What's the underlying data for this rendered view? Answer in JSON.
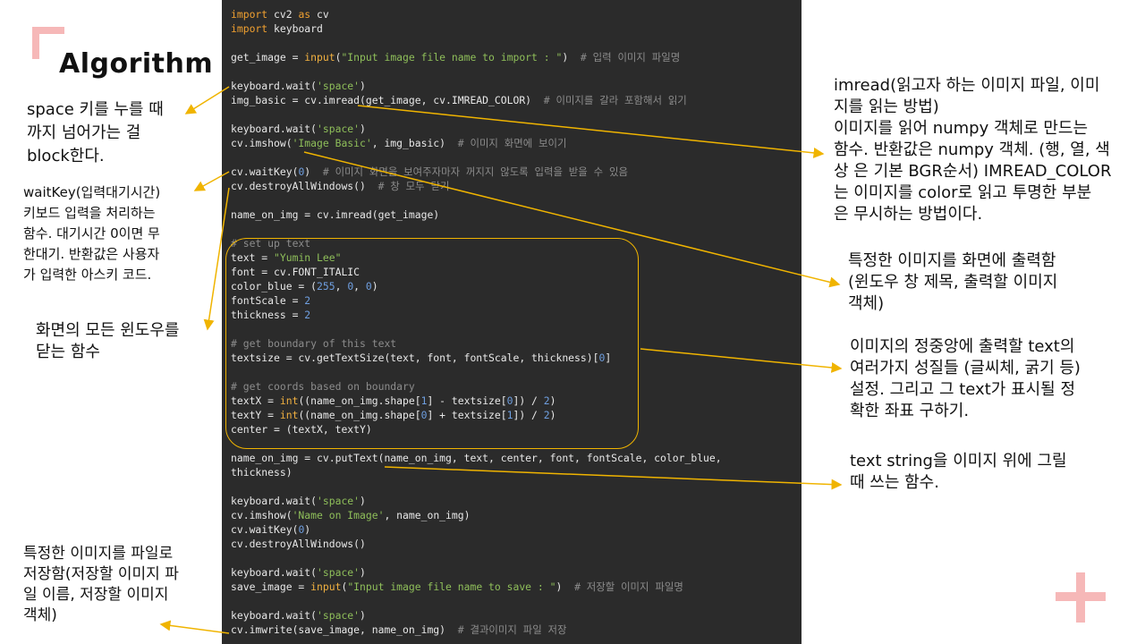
{
  "title": "Algorithm",
  "code_lines": [
    [
      [
        "kw",
        "import"
      ],
      [
        "t",
        " cv2 "
      ],
      [
        "kw",
        "as"
      ],
      [
        "t",
        " cv"
      ]
    ],
    [
      [
        "kw",
        "import"
      ],
      [
        "t",
        " keyboard"
      ]
    ],
    [],
    [
      [
        "t",
        "get_image = "
      ],
      [
        "fn",
        "input"
      ],
      [
        "t",
        "("
      ],
      [
        "str",
        "\"Input image file name to import : \""
      ],
      [
        "t",
        ")  "
      ],
      [
        "cmt",
        "# 입력 이미지 파일명"
      ]
    ],
    [],
    [
      [
        "t",
        "keyboard.wait("
      ],
      [
        "str",
        "'space'"
      ],
      [
        "t",
        ")"
      ]
    ],
    [
      [
        "t",
        "img_basic = cv.imread(get_image, cv.IMREAD_COLOR)  "
      ],
      [
        "cmt",
        "# 이미지를 갈라 포함해서 읽기"
      ]
    ],
    [],
    [
      [
        "t",
        "keyboard.wait("
      ],
      [
        "str",
        "'space'"
      ],
      [
        "t",
        ")"
      ]
    ],
    [
      [
        "t",
        "cv.imshow("
      ],
      [
        "str",
        "'Image Basic'"
      ],
      [
        "t",
        ", img_basic)  "
      ],
      [
        "cmt",
        "# 이미지 화면에 보이기"
      ]
    ],
    [],
    [
      [
        "t",
        "cv.waitKey("
      ],
      [
        "num",
        "0"
      ],
      [
        "t",
        ")  "
      ],
      [
        "cmt",
        "# 이미지 화면을 보여주자마자 꺼지지 않도록 입력을 받을 수 있음"
      ]
    ],
    [
      [
        "t",
        "cv.destroyAllWindows()  "
      ],
      [
        "cmt",
        "# 창 모두 닫기"
      ]
    ],
    [],
    [
      [
        "t",
        "name_on_img = cv.imread(get_image)"
      ]
    ],
    [],
    [
      [
        "cmt",
        "# set up text"
      ]
    ],
    [
      [
        "t",
        "text = "
      ],
      [
        "str",
        "\"Yumin Lee\""
      ]
    ],
    [
      [
        "t",
        "font = cv.FONT_ITALIC"
      ]
    ],
    [
      [
        "t",
        "color_blue = ("
      ],
      [
        "num",
        "255"
      ],
      [
        "t",
        ", "
      ],
      [
        "num",
        "0"
      ],
      [
        "t",
        ", "
      ],
      [
        "num",
        "0"
      ],
      [
        "t",
        ")"
      ]
    ],
    [
      [
        "t",
        "fontScale = "
      ],
      [
        "num",
        "2"
      ]
    ],
    [
      [
        "t",
        "thickness = "
      ],
      [
        "num",
        "2"
      ]
    ],
    [],
    [
      [
        "cmt",
        "# get boundary of this text"
      ]
    ],
    [
      [
        "t",
        "textsize = cv.getTextSize(text, font, fontScale, thickness)["
      ],
      [
        "num",
        "0"
      ],
      [
        "t",
        "]"
      ]
    ],
    [],
    [
      [
        "cmt",
        "# get coords based on boundary"
      ]
    ],
    [
      [
        "t",
        "textX = "
      ],
      [
        "fn",
        "int"
      ],
      [
        "t",
        "((name_on_img.shape["
      ],
      [
        "num",
        "1"
      ],
      [
        "t",
        "] - textsize["
      ],
      [
        "num",
        "0"
      ],
      [
        "t",
        "]) / "
      ],
      [
        "num",
        "2"
      ],
      [
        "t",
        ")"
      ]
    ],
    [
      [
        "t",
        "textY = "
      ],
      [
        "fn",
        "int"
      ],
      [
        "t",
        "((name_on_img.shape["
      ],
      [
        "num",
        "0"
      ],
      [
        "t",
        "] + textsize["
      ],
      [
        "num",
        "1"
      ],
      [
        "t",
        "]) / "
      ],
      [
        "num",
        "2"
      ],
      [
        "t",
        ")"
      ]
    ],
    [
      [
        "t",
        "center = (textX, textY)"
      ]
    ],
    [],
    [
      [
        "t",
        "name_on_img = cv.putText(name_on_img, text, center, font, fontScale, color_blue,"
      ]
    ],
    [
      [
        "t",
        "thickness)"
      ]
    ],
    [],
    [
      [
        "t",
        "keyboard.wait("
      ],
      [
        "str",
        "'space'"
      ],
      [
        "t",
        ")"
      ]
    ],
    [
      [
        "t",
        "cv.imshow("
      ],
      [
        "str",
        "'Name on Image'"
      ],
      [
        "t",
        ", name_on_img)"
      ]
    ],
    [
      [
        "t",
        "cv.waitKey("
      ],
      [
        "num",
        "0"
      ],
      [
        "t",
        ")"
      ]
    ],
    [
      [
        "t",
        "cv.destroyAllWindows()"
      ]
    ],
    [],
    [
      [
        "t",
        "keyboard.wait("
      ],
      [
        "str",
        "'space'"
      ],
      [
        "t",
        ")"
      ]
    ],
    [
      [
        "t",
        "save_image = "
      ],
      [
        "fn",
        "input"
      ],
      [
        "t",
        "("
      ],
      [
        "str",
        "\"Input image file name to save : \""
      ],
      [
        "t",
        ")  "
      ],
      [
        "cmt",
        "# 저장할 이미지 파일명"
      ]
    ],
    [],
    [
      [
        "t",
        "keyboard.wait("
      ],
      [
        "str",
        "'space'"
      ],
      [
        "t",
        ")"
      ]
    ],
    [
      [
        "t",
        "cv.imwrite(save_image, name_on_img)  "
      ],
      [
        "cmt",
        "# 결과이미지 파일 저장"
      ]
    ]
  ],
  "notes": {
    "keyboard_wait": "space 키를 누를 때\n까지 넘어가는 걸\nblock한다.",
    "waitkey": "waitKey(입력대기시간)\n키보드 입력을 처리하는\n함수. 대기시간 0이면 무\n한대기. 반환값은 사용자\n가 입력한 아스키 코드.",
    "destroy": "화면의 모든 윈도우를\n닫는 함수",
    "imwrite": "특정한 이미지를 파일로\n저장함(저장할 이미지 파\n일 이름, 저장할 이미지\n객체)",
    "imread": "imread(읽고자 하는 이미지 파일, 이미\n지를 읽는 방법)\n이미지를 읽어 numpy 객체로 만드는\n함수. 반환값은 numpy 객체. (행, 열, 색\n상 은 기본 BGR순서) IMREAD_COLOR\n는 이미지를 color로 읽고 투명한 부분\n은 무시하는 방법이다.",
    "imshow": "특정한 이미지를 화면에 출력함\n(윈도우 창 제목, 출력할 이미지\n객체)",
    "text_setup": "이미지의 정중앙에 출력할 text의\n여러가지 성질들 (글씨체, 굵기 등)\n설정. 그리고 그 text가 표시될 정\n확한 좌표 구하기.",
    "puttext": "text string을 이미지 위에 그릴\n때 쓰는 함수."
  },
  "colors": {
    "code_bg": "#2b2b2b",
    "highlight": "#f0b400",
    "accent_pink": "#f6b8b8"
  }
}
